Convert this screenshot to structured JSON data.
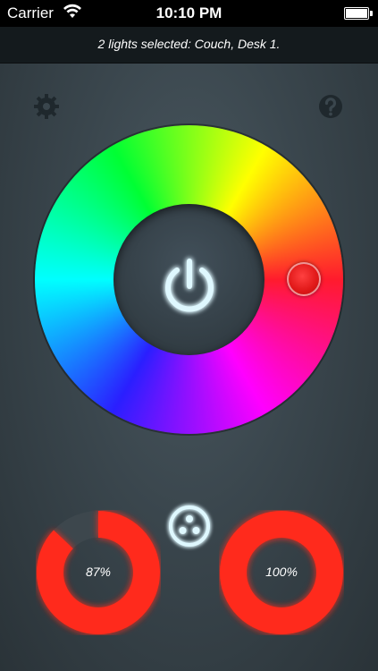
{
  "status_bar": {
    "carrier": "Carrier",
    "time": "10:10 PM"
  },
  "header": {
    "selection_text": "2 lights selected: Couch, Desk 1."
  },
  "toolbar": {
    "settings_icon": "gear-icon",
    "help_icon": "help-icon"
  },
  "color_wheel": {
    "selected_color": "#ff1b2d",
    "power_icon": "power-icon",
    "glow_color": "#7fe8ff"
  },
  "controls": {
    "brightness": {
      "value": 87,
      "label": "87%"
    },
    "saturation": {
      "value": 100,
      "label": "100%"
    },
    "group_icon": "group-lights-icon"
  },
  "colors": {
    "accent_glow": "#7fe8ff",
    "dial_fill": "#ff2a1a",
    "dial_track": "#3d474d"
  }
}
